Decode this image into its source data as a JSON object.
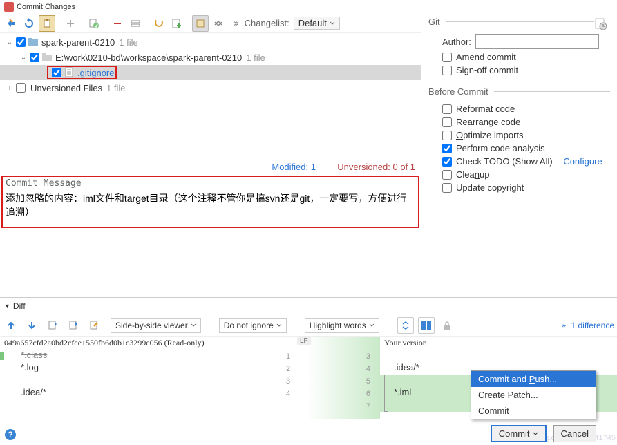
{
  "window": {
    "title": "Commit Changes"
  },
  "toolbar": {
    "changelist_label": "Changelist:",
    "changelist_value": "Default"
  },
  "tree": {
    "root": {
      "name": "spark-parent-0210",
      "count": "1 file"
    },
    "path": {
      "name": "E:\\work\\0210-bd\\workspace\\spark-parent-0210",
      "count": "1 file"
    },
    "file": {
      "name": ".gitignore"
    },
    "unversioned": {
      "name": "Unversioned Files",
      "count": "1 file"
    }
  },
  "status": {
    "modified": "Modified: 1",
    "unversioned": "Unversioned: 0 of 1"
  },
  "commit": {
    "header": "Commit Message",
    "message": "添加忽略的内容：iml文件和target目录（这个注释不管你是搞svn还是git，一定要写，方便进行追溯）"
  },
  "git": {
    "section": "Git",
    "author_label": "Author:",
    "amend": "Amend commit",
    "signoff": "Sign-off commit"
  },
  "before": {
    "section": "Before Commit",
    "reformat": "Reformat code",
    "rearrange": "Rearrange code",
    "optimize": "Optimize imports",
    "analysis": "Perform code analysis",
    "todo": "Check TODO (Show All)",
    "todo_configure": "Configure",
    "cleanup": "Cleanup",
    "copyright": "Update copyright"
  },
  "diff": {
    "header": "Diff",
    "viewer": "Side-by-side viewer",
    "ignore": "Do not ignore",
    "highlight": "Highlight words",
    "diff_count": "1 difference",
    "hash": "049a657cfd2a0bd2cfce1550fb6d0b1c3299c056 (Read-only)",
    "lf": "LF",
    "your_version": "Your version",
    "left_lines": [
      "*.class",
      "*.log",
      "",
      ".idea/*"
    ],
    "left_gutter": [
      "1",
      "2",
      "3",
      "4"
    ],
    "right_lines": [
      "",
      ".idea/*",
      "",
      "*.iml",
      ""
    ],
    "right_gutter": [
      "3",
      "4",
      "5",
      "6",
      "7"
    ],
    "mid_left": [
      "1",
      "2",
      "3",
      "4"
    ]
  },
  "menu": {
    "commit_push": "Commit and Push...",
    "create_patch": "Create Patch...",
    "commit": "Commit"
  },
  "buttons": {
    "commit": "Commit",
    "cancel": "Cancel"
  },
  "watermark": "https://blog.csdn.net/qq_41745"
}
